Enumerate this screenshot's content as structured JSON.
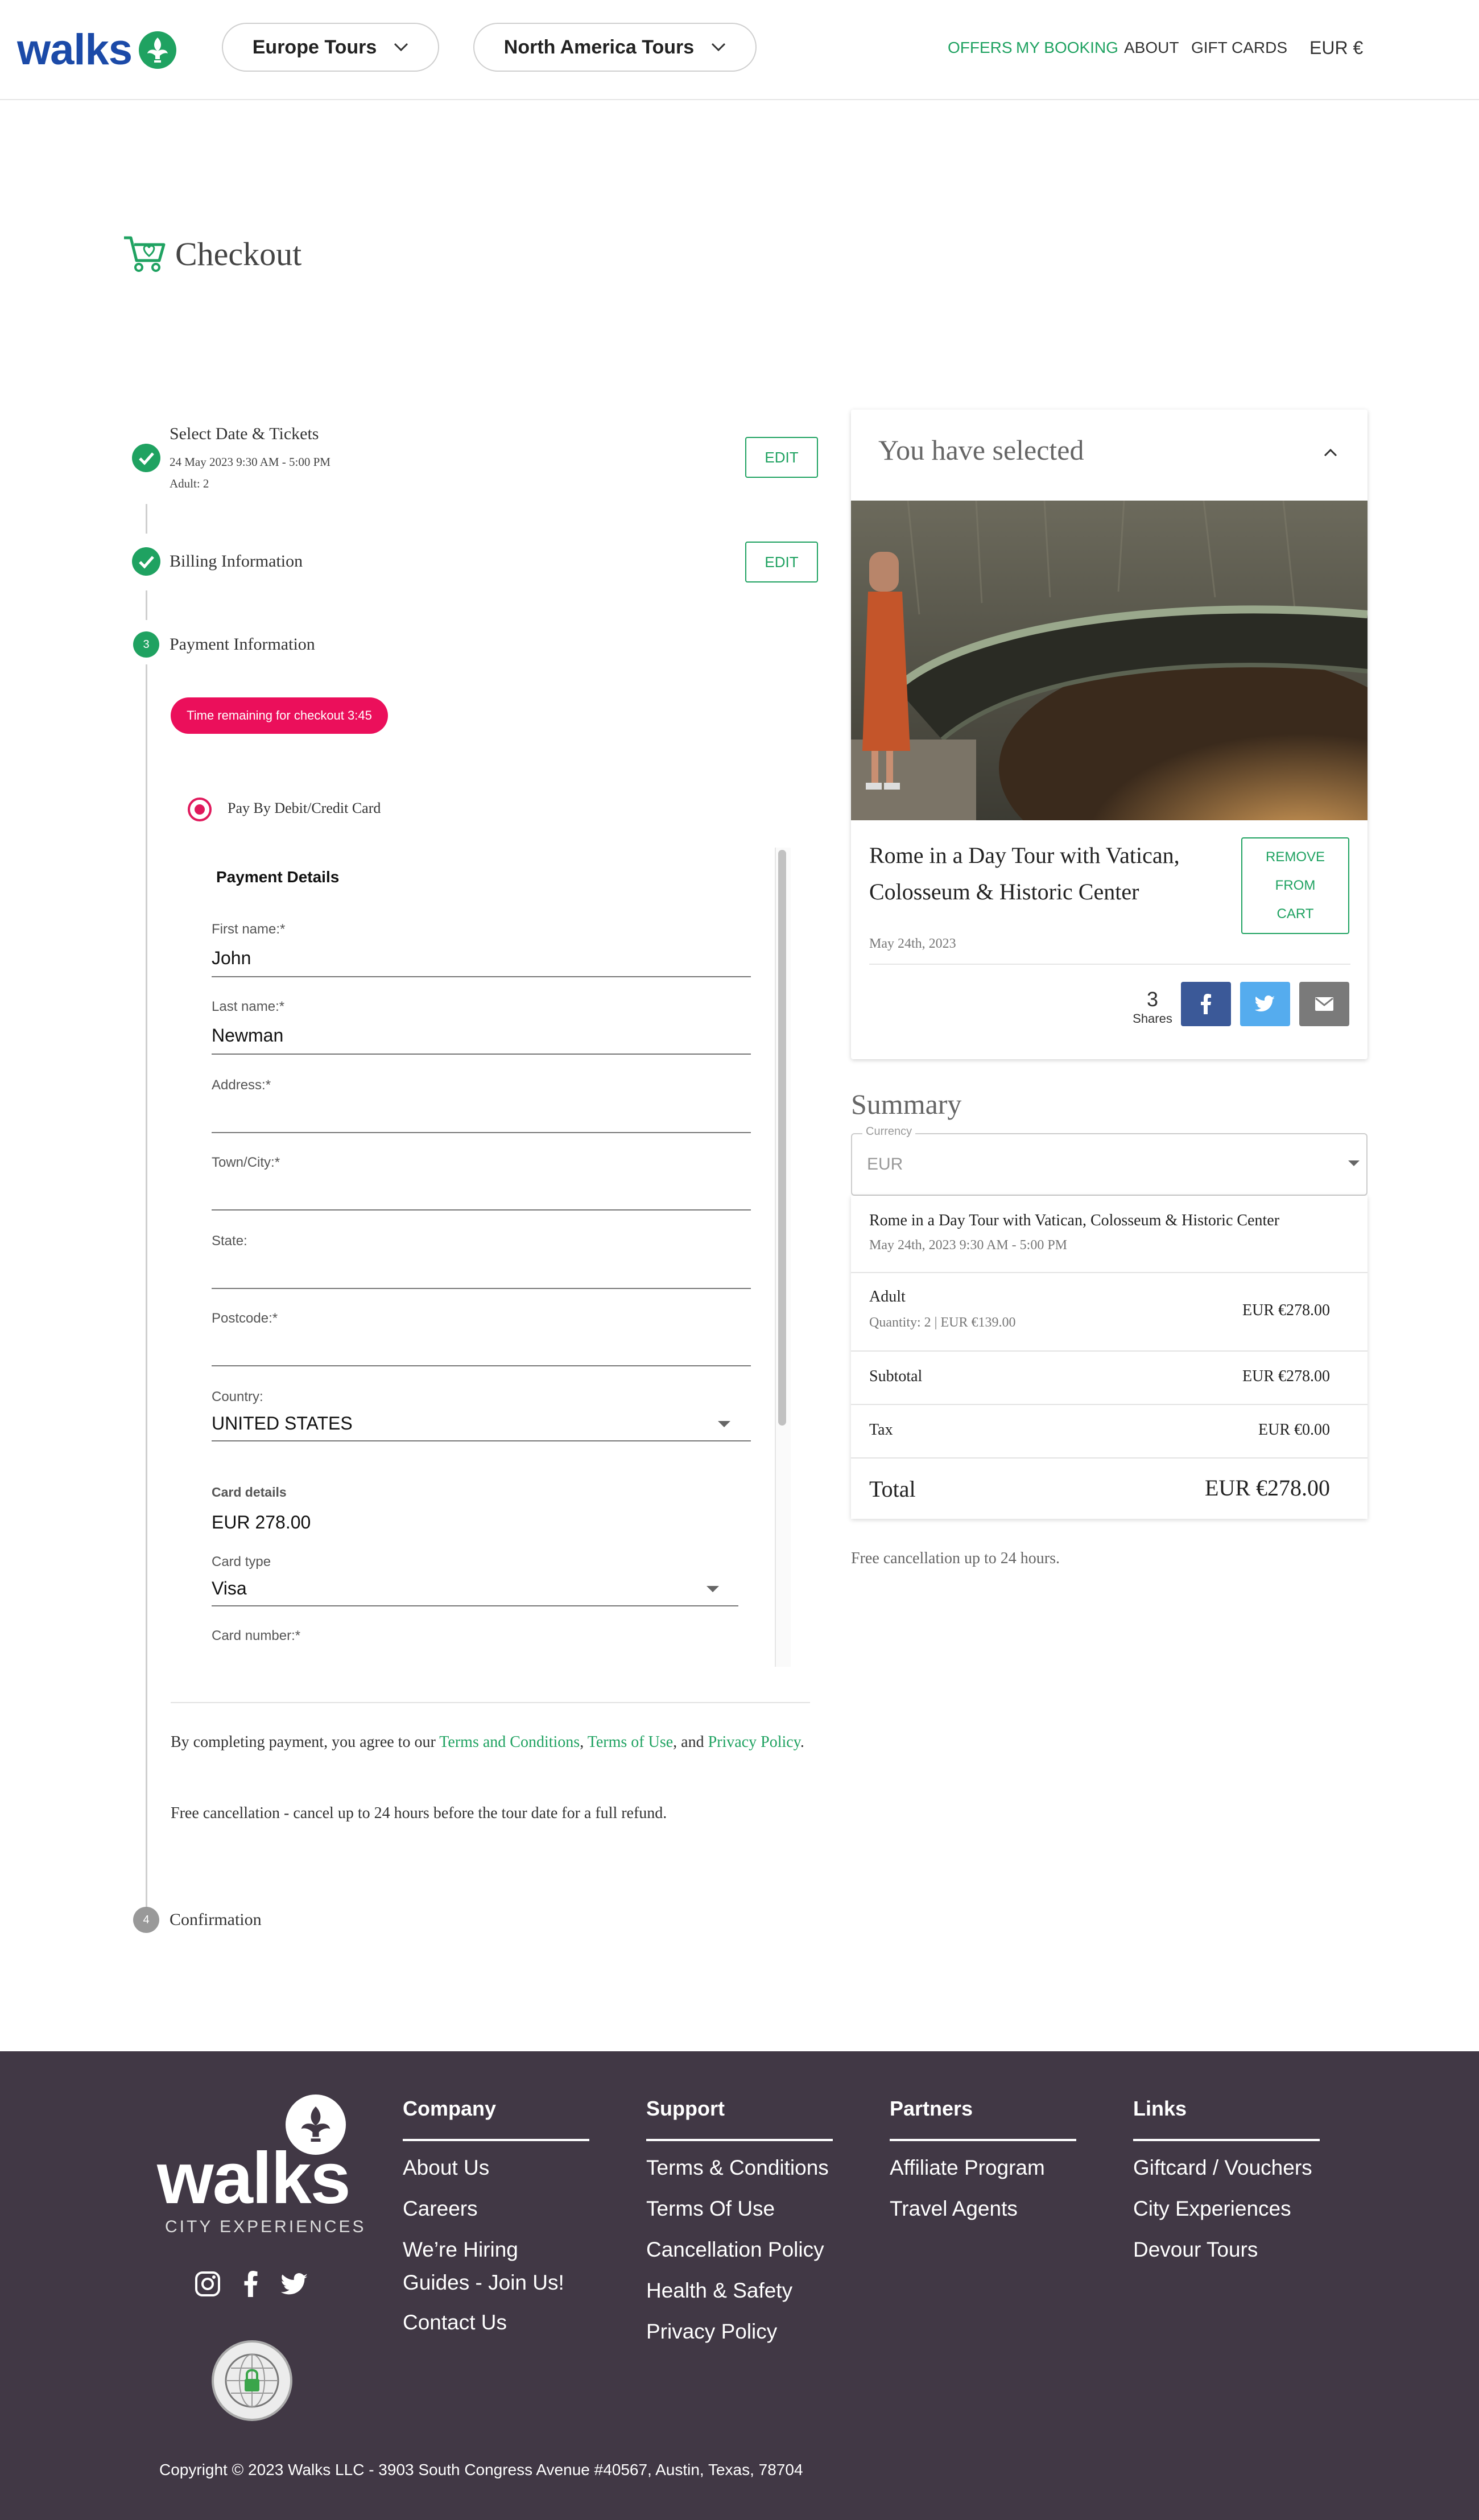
{
  "header": {
    "logo_text": "walks",
    "tours": [
      {
        "label": "Europe Tours"
      },
      {
        "label": "North America Tours"
      }
    ],
    "nav": {
      "offers": "OFFERS",
      "my_booking": "MY BOOKING",
      "about": "ABOUT",
      "gift_cards": "GIFT CARDS",
      "currency": "EUR €"
    }
  },
  "checkout": {
    "title": "Checkout",
    "steps": {
      "s1": {
        "label": "Select Date & Tickets",
        "date": "24 May 2023 9:30 AM - 5:00 PM",
        "tickets": "Adult: 2",
        "edit": "EDIT"
      },
      "s2": {
        "label": "Billing Information",
        "edit": "EDIT"
      },
      "s3": {
        "num": "3",
        "label": "Payment Information"
      },
      "s4": {
        "num": "4",
        "label": "Confirmation"
      }
    },
    "timer": "Time remaining for checkout 3:45",
    "pay_option": "Pay By Debit/Credit Card",
    "payment": {
      "title": "Payment Details",
      "first_name_label": "First name:*",
      "first_name": "John",
      "last_name_label": "Last name:*",
      "last_name": "Newman",
      "address_label": "Address:*",
      "town_label": "Town/City:*",
      "state_label": "State:",
      "postcode_label": "Postcode:*",
      "country_label": "Country:",
      "country": "UNITED STATES",
      "card_details_label": "Card details",
      "amount": "EUR 278.00",
      "card_type_label": "Card type",
      "card_type": "Visa",
      "card_number_label": "Card number:*"
    },
    "terms": {
      "prefix": "By completing payment, you agree to our ",
      "terms_link": "Terms and Conditions",
      "sep1": ", ",
      "use_link": "Terms of Use",
      "sep2": ", and ",
      "privacy_link": "Privacy Policy",
      "end": ".",
      "free_cancel": "Free cancellation - cancel up to 24 hours before the tour date for a full refund."
    }
  },
  "selected": {
    "title": "You have selected",
    "tour_name": "Rome in a Day Tour with Vatican, Colosseum & Historic Center",
    "remove_lines": [
      "REMOVE",
      "FROM",
      "CART"
    ],
    "date": "May 24th, 2023",
    "shares_count": "3",
    "shares_label": "Shares"
  },
  "summary": {
    "title": "Summary",
    "currency_legend": "Currency",
    "currency_value": "EUR",
    "tour_name": "Rome in a Day Tour with Vatican, Colosseum & Historic Center",
    "tour_time": "May 24th, 2023 9:30 AM - 5:00 PM",
    "adult_label": "Adult",
    "adult_qty": "Quantity: 2 | EUR €139.00",
    "adult_price": "EUR €278.00",
    "subtotal_label": "Subtotal",
    "subtotal": "EUR €278.00",
    "tax_label": "Tax",
    "tax": "EUR €0.00",
    "total_label": "Total",
    "total": "EUR €278.00",
    "free_note": "Free cancellation up to 24 hours."
  },
  "footer": {
    "logo_text": "walks",
    "logo_sub": "CITY EXPERIENCES",
    "cols": [
      {
        "head": "Company",
        "links": [
          "About Us",
          "Careers",
          "We’re Hiring",
          "Guides - Join Us!",
          "Contact Us"
        ]
      },
      {
        "head": "Support",
        "links": [
          "Terms & Conditions",
          "Terms Of Use",
          "Cancellation Policy",
          "Health & Safety",
          "Privacy Policy"
        ]
      },
      {
        "head": "Partners",
        "links": [
          "Affiliate Program",
          "Travel Agents"
        ]
      },
      {
        "head": "Links",
        "links": [
          "Giftcard / Vouchers",
          "City Experiences",
          "Devour Tours"
        ]
      }
    ],
    "copyright": "Copyright © 2023 Walks LLC - 3903 South Congress Avenue #40567, Austin, Texas, 78704"
  },
  "colors": {
    "brand_green": "#1fa261",
    "brand_blue": "#1b4aa8",
    "timer_pink": "#eb0f5b",
    "footer_bg": "#413845",
    "facebook": "#3b5998",
    "twitter": "#55acee",
    "email": "#7a7a7a"
  }
}
